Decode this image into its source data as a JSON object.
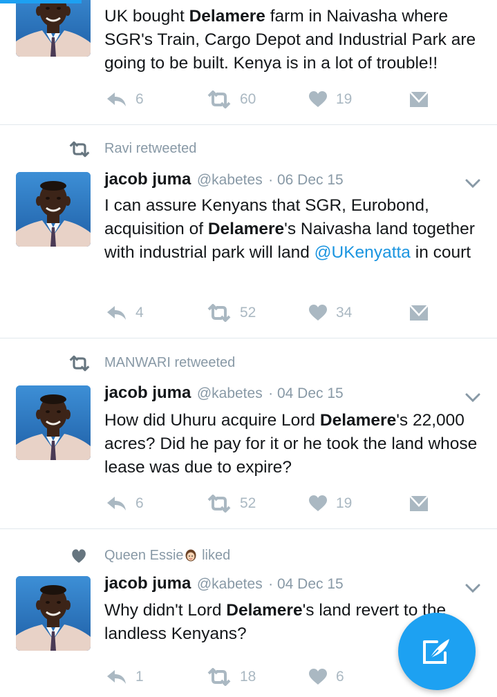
{
  "tweets": [
    {
      "context": null,
      "author": null,
      "text_parts": [
        {
          "t": "UK bought "
        },
        {
          "t": "Delamere",
          "b": true
        },
        {
          "t": " farm in Naivasha where SGR's Train, Cargo Depot and Industrial Park are going to be built. Kenya is in a lot of trouble!!"
        }
      ],
      "replies": "6",
      "retweets": "60",
      "likes": "19"
    },
    {
      "context": {
        "icon": "retweet-icon",
        "text": "Ravi retweeted"
      },
      "author": {
        "name": "jacob juma",
        "handle": "@kabetes",
        "date": "· 06 Dec 15"
      },
      "text_parts": [
        {
          "t": "I can assure Kenyans that SGR, Eurobond, acquisition of "
        },
        {
          "t": "Delamere",
          "b": true
        },
        {
          "t": "'s Naivasha land together with industrial park will land "
        },
        {
          "t": "@UKenyatta",
          "m": true
        },
        {
          "t": " in court"
        }
      ],
      "replies": "4",
      "retweets": "52",
      "likes": "34"
    },
    {
      "context": {
        "icon": "retweet-icon",
        "text": "MANWARI retweeted"
      },
      "author": {
        "name": "jacob juma",
        "handle": "@kabetes",
        "date": "· 04 Dec 15"
      },
      "text_parts": [
        {
          "t": "How did Uhuru acquire Lord "
        },
        {
          "t": "Delamere",
          "b": true
        },
        {
          "t": "'s 22,000 acres? Did he pay for it or he took the land whose lease was due to expire?"
        }
      ],
      "replies": "6",
      "retweets": "52",
      "likes": "19"
    },
    {
      "context": {
        "icon": "heart-icon",
        "text": "Queen Essie",
        "suffix": "liked",
        "emoji": "woman-emoji"
      },
      "author": {
        "name": "jacob juma",
        "handle": "@kabetes",
        "date": "· 04 Dec 15"
      },
      "text_parts": [
        {
          "t": "Why didn't Lord "
        },
        {
          "t": "Delamere",
          "b": true
        },
        {
          "t": "'s land revert to the landless Kenyans?"
        }
      ],
      "replies": "1",
      "retweets": "18",
      "likes": "6"
    }
  ],
  "fab": {
    "icon": "compose-tweet-icon"
  },
  "colors": {
    "accent": "#1da1f2",
    "link": "#1b95e0",
    "muted": "#8899a6",
    "action": "#aab8c2"
  }
}
